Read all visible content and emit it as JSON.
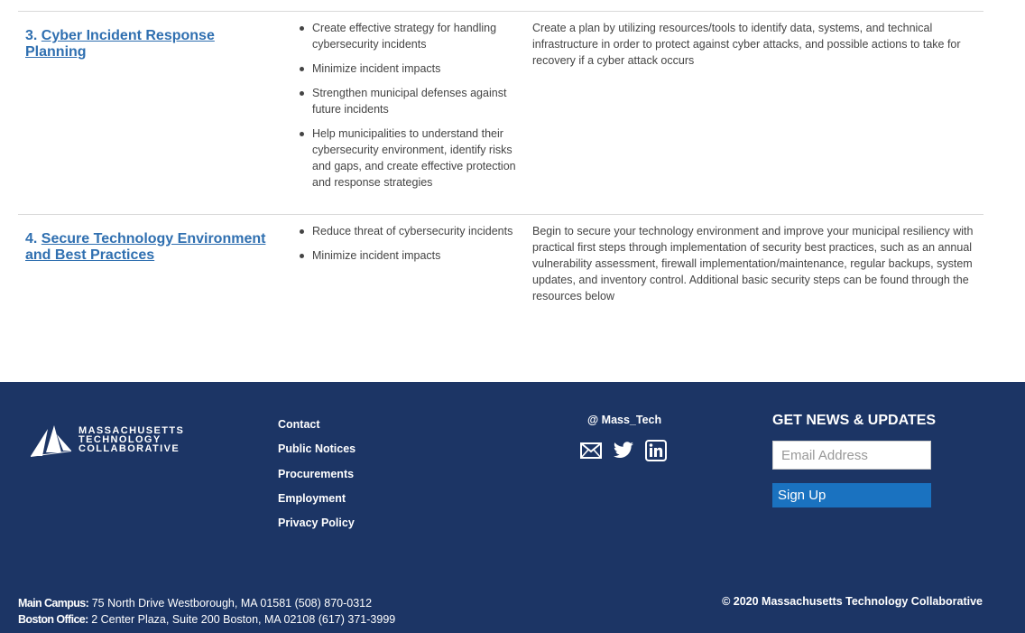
{
  "rows": [
    {
      "number": "3.",
      "title": "Cyber Incident Response Planning",
      "goals": [
        "Create effective strategy for handling cybersecurity incidents",
        "Minimize incident impacts",
        "Strengthen municipal defenses against future incidents",
        "Help municipalities to understand their cybersecurity environment, identify risks and gaps, and create effective protection and response strategies"
      ],
      "description": "Create a plan by utilizing resources/tools to identify data, systems, and technical infrastructure in order to protect against cyber attacks, and possible actions to take for recovery if a cyber attack occurs"
    },
    {
      "number": "4.",
      "title": "Secure Technology Environment and Best Practices",
      "goals": [
        "Reduce threat of cybersecurity incidents",
        "Minimize incident impacts"
      ],
      "description": "Begin to secure your technology environment and improve your municipal resiliency with practical first steps through implementation of security best practices, such as an annual vulnerability assessment, firewall implementation/maintenance, regular backups, system updates, and inventory control. Additional basic security steps can be found through the resources below"
    }
  ],
  "footer": {
    "logo_text": "MASSACHUSETTS\nTECHNOLOGY\nCOLLABORATIVE",
    "links": [
      "Contact",
      "Public Notices",
      "Procurements",
      "Employment",
      "Privacy Policy"
    ],
    "social_handle": "@ Mass_Tech",
    "social_icons": [
      "email-icon",
      "twitter-icon",
      "linkedin-icon"
    ],
    "news_heading": "GET NEWS & UPDATES",
    "email_placeholder": "Email Address",
    "signup_label": "Sign Up",
    "main_campus_label": "Main Campus:",
    "main_campus_text": " 75 North Drive Westborough, MA 01581 (508) 870-0312",
    "boston_label": "Boston Office:",
    "boston_text": " 2 Center Plaza, Suite 200 Boston, MA 02108 (617) 371-3999",
    "copyright": "© 2020 Massachusetts Technology Collaborative"
  },
  "colors": {
    "footer_bg": "#1c3565",
    "link": "#2f6fb0",
    "signup_bg": "#1a72c0"
  }
}
